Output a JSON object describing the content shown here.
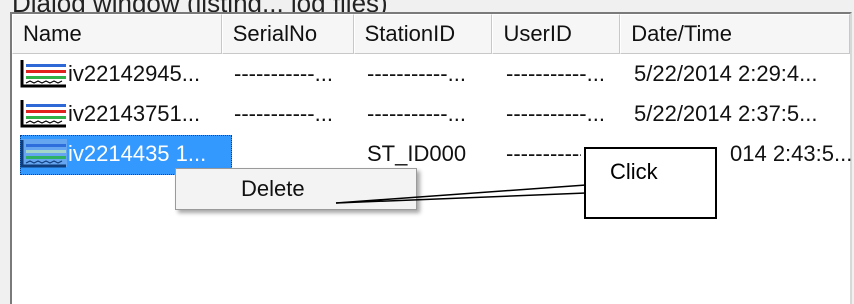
{
  "caption_cut": "Dialog window (listing... log files)",
  "columns": {
    "name": "Name",
    "serial": "SerialNo",
    "station": "StationID",
    "user": "UserID",
    "datetime": "Date/Time"
  },
  "rows": [
    {
      "name": "iv22142945...",
      "serial": "-----------...",
      "station": "-----------...",
      "user": "-----------...",
      "datetime": "5/22/2014 2:29:4..."
    },
    {
      "name": "iv22143751...",
      "serial": "-----------...",
      "station": "-----------...",
      "user": "-----------...",
      "datetime": "5/22/2014 2:37:5..."
    },
    {
      "name": "iv2214435 1...",
      "station": "ST_ID000",
      "user": "-----------",
      "datetime": "014 2:43:5..."
    }
  ],
  "context_menu": {
    "delete_label": "Delete"
  },
  "callout": {
    "text": "Click"
  },
  "colors": {
    "selection": "#3399ff",
    "icon_black": "#000000",
    "icon_red": "#e0241d",
    "icon_green": "#2db34a",
    "icon_blue": "#2e67d6"
  }
}
